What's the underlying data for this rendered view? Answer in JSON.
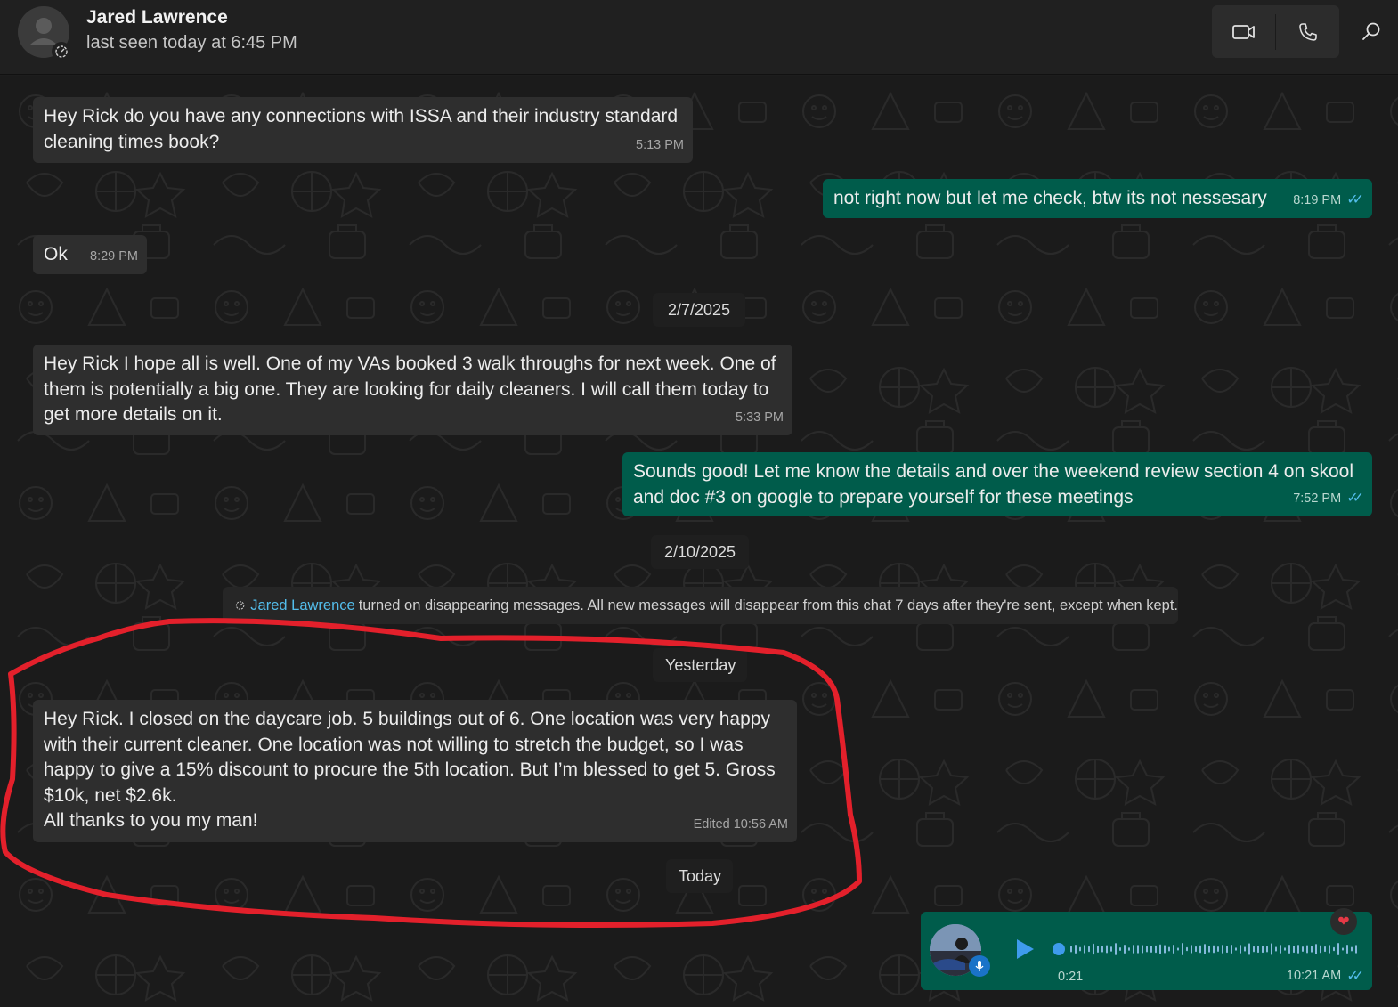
{
  "contact": {
    "name": "Jared Lawrence",
    "status": "last seen today at 6:45 PM"
  },
  "toolbar": {
    "video_call_icon": "video-camera-icon",
    "voice_call_icon": "phone-icon",
    "search_icon": "search-icon"
  },
  "messages": [
    {
      "direction": "in",
      "text_lines": [
        "Hey Rick do you have any connections with ISSA and their industry standard",
        "cleaning times book?"
      ],
      "time": "5:13 PM"
    },
    {
      "direction": "out",
      "text": "not right now but let me check, btw its not nessesary",
      "time": "8:19 PM"
    },
    {
      "direction": "in",
      "text": "Ok",
      "time": "8:29 PM"
    },
    {
      "direction": "in",
      "text_lines": [
        "Hey Rick I hope all is well. One of my VAs booked 3 walk throughs for next week. One of",
        "them is potentially a big one. They are looking for daily cleaners. I will call them today to",
        "get more details on it."
      ],
      "time": "5:33 PM"
    },
    {
      "direction": "out",
      "text_lines": [
        "Sounds good! Let me know the details and over the weekend review section 4 on skool",
        "and doc #3 on google to prepare yourself for these meetings"
      ],
      "time": "7:52 PM"
    },
    {
      "direction": "in",
      "text_lines": [
        "Hey Rick. I closed on the daycare job. 5 buildings out of 6. One location was very happy",
        "with their current cleaner. One location was not willing to stretch the budget, so I was",
        "happy to give a 15% discount to procure the 5th location. But I’m blessed to get 5. Gross",
        "$10k, net $2.6k.",
        "All thanks to you my man!"
      ],
      "time": "Edited 10:56 AM"
    }
  ],
  "dates": [
    "2/7/2025",
    "2/10/2025",
    "Yesterday",
    "Today"
  ],
  "system_note": {
    "actor": "Jared Lawrence",
    "text": "turned on disappearing messages. All new messages will disappear from this chat 7 days after they're sent, except when kept."
  },
  "voice_message": {
    "duration": "0:21",
    "time": "10:21 AM"
  },
  "reaction": "❤",
  "colors": {
    "outgoing_bubble": "#005c4b",
    "incoming_bubble": "#2e2e2e",
    "read_tick": "#53bdeb",
    "annotation_stroke": "#e3202b"
  }
}
